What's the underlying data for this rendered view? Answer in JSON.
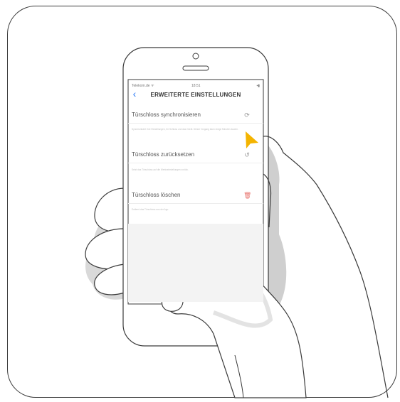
{
  "screen": {
    "status_bar": {
      "carrier": "Telekom.de ᯤ",
      "time": "18:51",
      "battery": "▪▮"
    },
    "nav_title": "ERWEITERTE EINSTELLUNGEN",
    "rows": [
      {
        "label": "Türschloss synchronisieren",
        "icon": "sync-icon",
        "description": "Synchronisiert Ihre Einstellungen, Ihr Schloss und das Gerät. Dieser Vorgang kann einige Minuten dauern."
      },
      {
        "label": "Türschloss zurücksetzen",
        "icon": "reset-icon",
        "description": "Setzt das Türschloss auf die Werkseinstellungen zurück."
      },
      {
        "label": "Türschloss löschen",
        "icon": "trash-icon",
        "description": "Entfernt das Türschloss aus der App."
      }
    ]
  },
  "colors": {
    "accent": "#2e7cf6",
    "cursor": "#f4b400",
    "delete": "#e8756f",
    "outline": "#3a3a3a",
    "shadow": "#cfcfcf"
  }
}
